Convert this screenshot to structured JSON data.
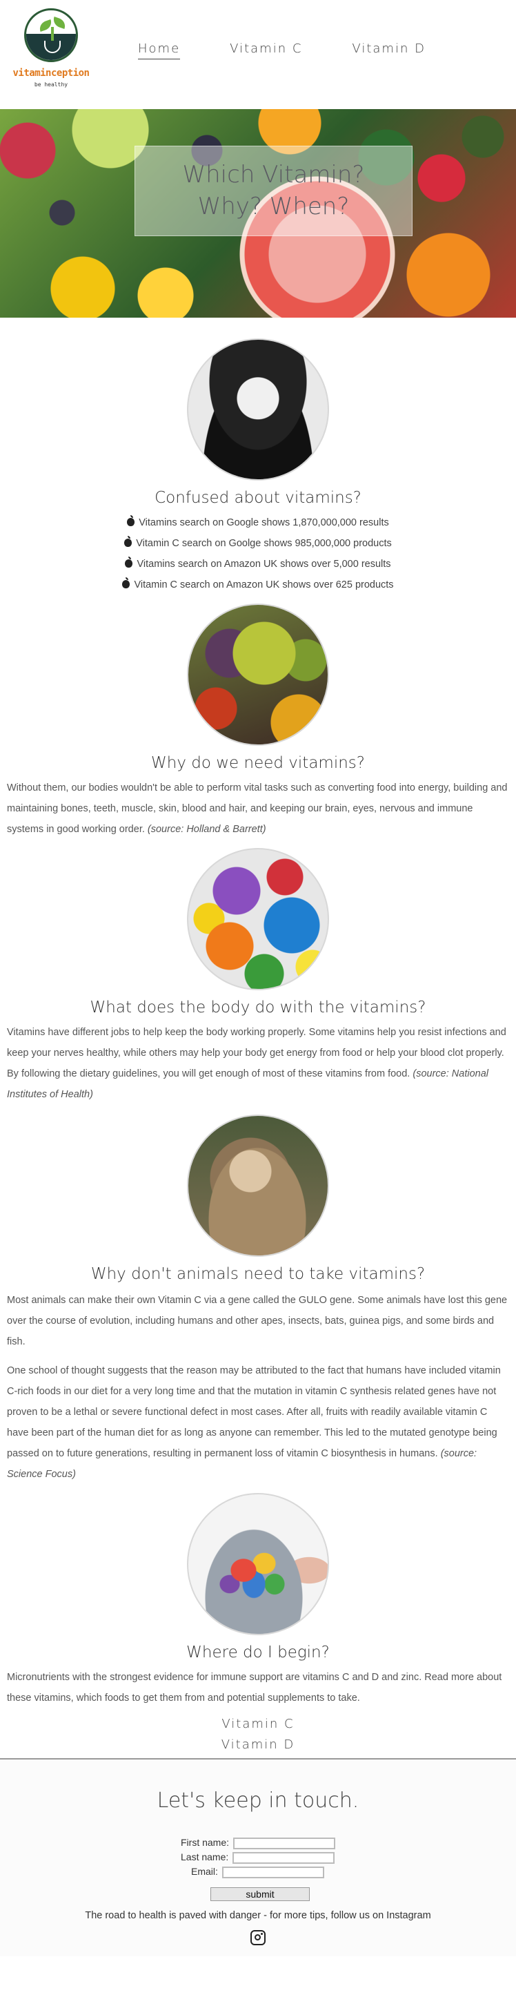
{
  "logo": {
    "wordmark": "vitaminception",
    "tagline": "be healthy"
  },
  "nav": {
    "items": [
      {
        "label": "Home",
        "active": true
      },
      {
        "label": "Vitamin C",
        "active": false
      },
      {
        "label": "Vitamin D",
        "active": false
      }
    ]
  },
  "hero": {
    "line1": "Which Vitamin?",
    "line2": "Why? When?"
  },
  "sections": {
    "confused": {
      "title": "Confused about vitamins?",
      "stats": [
        "Vitamins search on Google shows 1,870,000,000 results",
        "Vitamin C search on Goolge shows 985,000,000 products",
        "Vitamins search on Amazon UK shows over 5,000 results",
        "Vitamin C search on Amazon UK shows over 625 products"
      ]
    },
    "why": {
      "title": "Why do we need vitamins?",
      "text": "Without them, our bodies wouldn't be able to perform vital tasks such as converting food into energy, building and maintaining bones, teeth, muscle, skin, blood and hair, and keeping our brain, eyes, nervous and immune systems in good working order.",
      "source": "(source: Holland & Barrett)"
    },
    "body": {
      "title": "What does the body do with the vitamins?",
      "text": "Vitamins have different jobs to help keep the body working properly. Some vitamins help you resist infections and keep your nerves healthy, while others may help your body get energy from food or help your blood clot properly. By following the dietary guidelines, you will get enough of most of these vitamins from food.",
      "source": "(source: National Institutes of Health)"
    },
    "animals": {
      "title": "Why don't animals need to take vitamins?",
      "text1": "Most animals can make their own Vitamin C via a gene called the GULO gene. Some animals have lost this gene over the course of evolution, including humans and other apes, insects, bats, guinea pigs, and some birds and fish.",
      "text2": "One school of thought suggests that the reason may be attributed to the fact that humans have included vitamin C-rich foods in our diet for a very long time and that the mutation in vitamin C synthesis related genes have not proven to be a lethal or severe functional defect in most cases. After all, fruits with readily available vitamin C have been part of the human diet for as long as anyone can remember. This led to the mutated genotype being passed on to future generations, resulting in permanent loss of vitamin C biosynthesis in humans.",
      "source": "(source: Science Focus)"
    },
    "begin": {
      "title": "Where do I begin?",
      "text": "Micronutrients with the strongest evidence for immune support are vitamins C and D and zinc. Read more about these vitamins, which foods to get them from and potential supplements to take.",
      "links": [
        "Vitamin C",
        "Vitamin D"
      ]
    }
  },
  "footer": {
    "title": "Let's keep in touch.",
    "first_name_label": "First name:",
    "last_name_label": "Last name:",
    "email_label": "Email:",
    "submit_label": "submit",
    "tagline": "The road to health is paved with danger - for more tips, follow us on Instagram"
  }
}
